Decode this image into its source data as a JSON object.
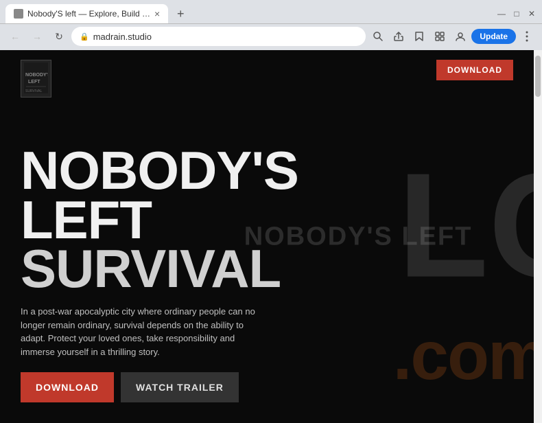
{
  "browser": {
    "tab": {
      "favicon_alt": "favicon",
      "title": "Nobody'S left — Explore, Build …",
      "close_label": "×"
    },
    "new_tab_label": "+",
    "window_controls": {
      "minimize": "—",
      "maximize": "□",
      "close": "✕"
    },
    "nav": {
      "back": "←",
      "forward": "→",
      "refresh": "↻"
    },
    "address": "madrain.studio",
    "toolbar": {
      "search_icon": "🔍",
      "share_icon": "↗",
      "star_icon": "☆",
      "extension_icon": "⬜",
      "profile_icon": "👤",
      "update_label": "Update",
      "menu_icon": "⋮"
    }
  },
  "site": {
    "game_logo_text": "NOBODY'S\nLEFT",
    "download_top_label": "DOWNLOAD",
    "title_line1": "NOBODY'S",
    "title_line2": "LEFT",
    "title_line3": "SURVIVAL",
    "center_watermark": "NOBODY'S LEFT",
    "com_watermark": ".com",
    "description": "In a post-war apocalyptic city where ordinary people can no longer remain ordinary, survival depends on the ability to adapt. Protect your loved ones, take responsibility and immerse yourself in a thrilling story.",
    "download_cta_label": "DOWNLOAD",
    "trailer_label": "WATCH TRAILER"
  }
}
